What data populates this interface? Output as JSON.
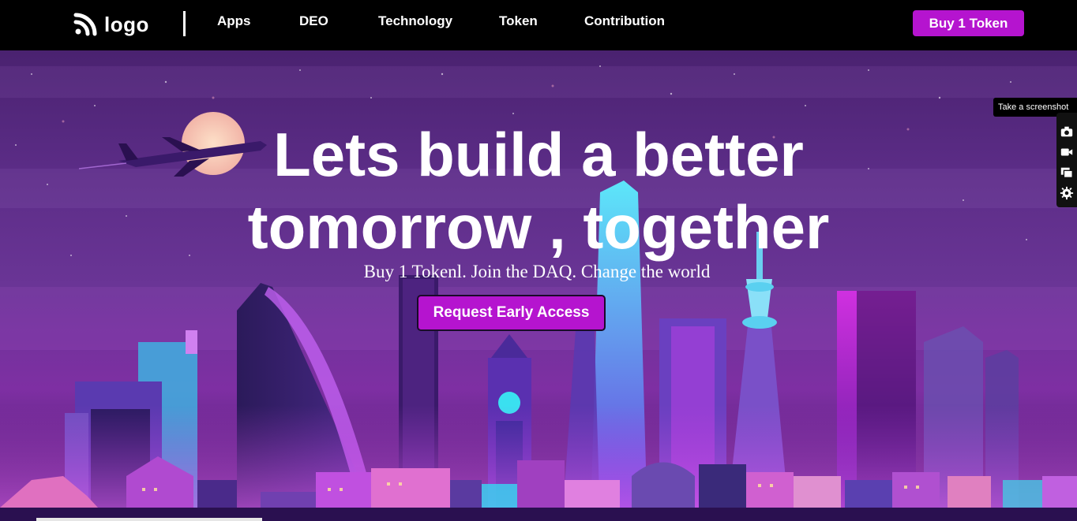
{
  "nav": {
    "logo_text": "logo",
    "links": [
      "Apps",
      "DEO",
      "Technology",
      "Token",
      "Contribution"
    ],
    "buy_label": "Buy 1 Token"
  },
  "hero": {
    "title": "Lets build a better tomorrow , together",
    "subtitle": "Buy 1 Tokenl. Join the DAQ. Change the world",
    "cta_label": "Request Early Access"
  },
  "widget": {
    "tooltip": "Take a screenshot",
    "icons": [
      "camera-icon",
      "video-icon",
      "windows-icon",
      "gear-icon"
    ]
  },
  "colors": {
    "accent": "#b514cf",
    "navbar_bg": "#000000",
    "sky_top": "#4a2270",
    "sky_bottom": "#7e2fa3"
  }
}
